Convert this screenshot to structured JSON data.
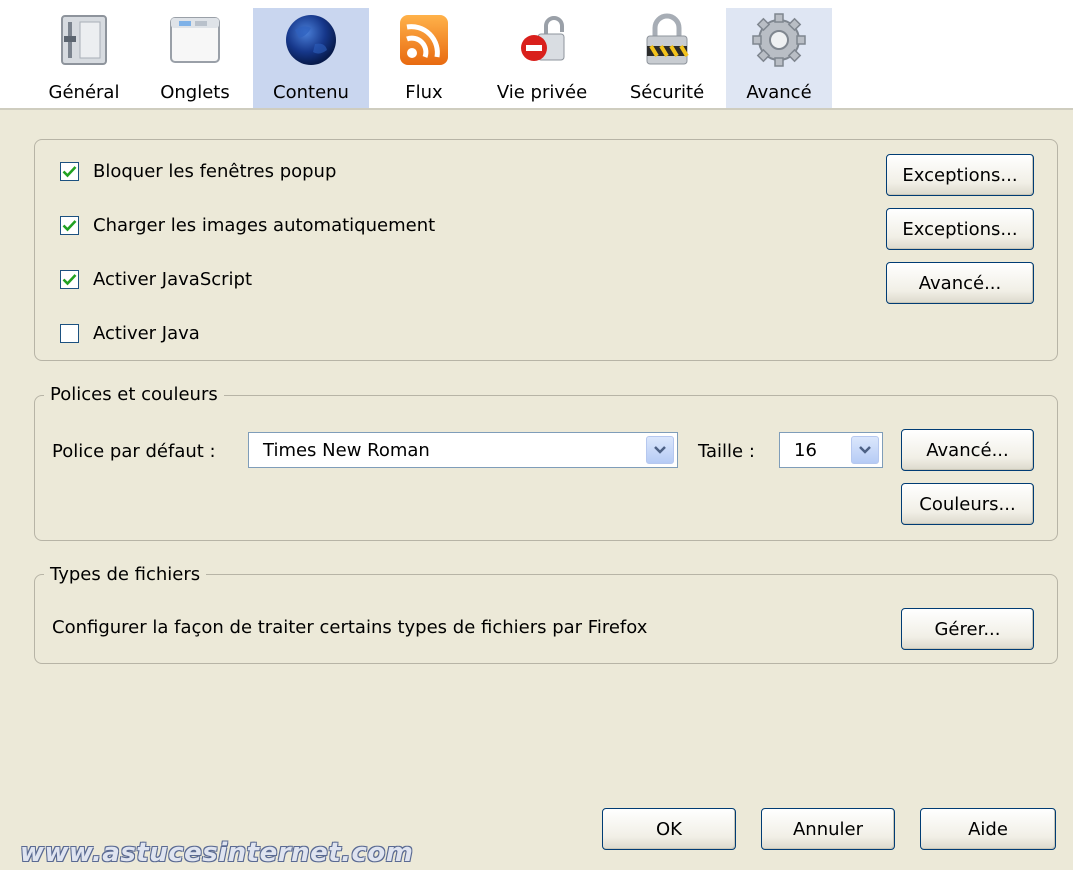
{
  "toolbar": {
    "tabs": [
      {
        "label": "Général",
        "icon": "general-icon"
      },
      {
        "label": "Onglets",
        "icon": "tabs-window-icon"
      },
      {
        "label": "Contenu",
        "icon": "globe-icon",
        "selected": true
      },
      {
        "label": "Flux",
        "icon": "rss-feed-icon"
      },
      {
        "label": "Vie privée",
        "icon": "privacy-lock-icon"
      },
      {
        "label": "Sécurité",
        "icon": "security-padlock-icon"
      },
      {
        "label": "Avancé",
        "icon": "gear-icon"
      }
    ]
  },
  "content": {
    "options": [
      {
        "label": "Bloquer les fenêtres popup",
        "checked": true,
        "button": "Exceptions..."
      },
      {
        "label": "Charger les images automatiquement",
        "checked": true,
        "button": "Exceptions..."
      },
      {
        "label": "Activer JavaScript",
        "checked": true,
        "button": "Avancé..."
      },
      {
        "label": "Activer Java",
        "checked": false
      }
    ]
  },
  "fonts": {
    "legend": "Polices et couleurs",
    "default_font_label": "Police par défaut :",
    "default_font_value": "Times New Roman",
    "size_label": "Taille :",
    "size_value": "16",
    "advanced_button": "Avancé...",
    "colors_button": "Couleurs..."
  },
  "filetypes": {
    "legend": "Types de fichiers",
    "description": "Configurer la façon de traiter certains types de fichiers par Firefox",
    "manage_button": "Gérer..."
  },
  "dialog_buttons": {
    "ok": "OK",
    "cancel": "Annuler",
    "help": "Aide"
  },
  "watermark": "www.astucesinternet.com",
  "colors": {
    "background": "#ece9d8",
    "selected_tab": "#c9d6ef",
    "checkbox_mark": "#21a121",
    "button_border": "#003c74"
  }
}
